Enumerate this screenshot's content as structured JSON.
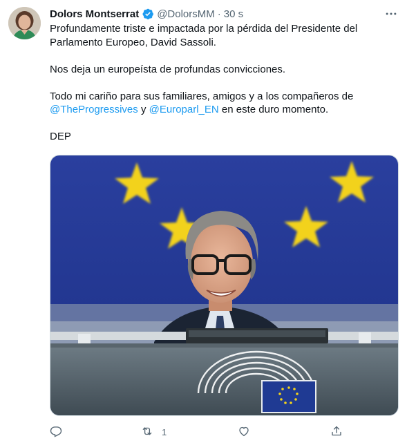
{
  "tweet": {
    "author_name": "Dolors Montserrat",
    "handle": "@DolorsMM",
    "separator": "·",
    "time": "30 s",
    "line1": "Profundamente triste e impactada por la pérdida del Presidente del",
    "line2": "Parlamento Europeo, David Sassoli.",
    "para2": "Nos deja un europeísta de profundas convicciones.",
    "para3_line1": "Todo mi cariño para sus familiares, amigos y a los compañeros de",
    "mention1": "@TheProgressives",
    "and": " y ",
    "mention2": "@Europarl_EN",
    "para3_end": " en este duro momento.",
    "para4": "DEP"
  },
  "actions": {
    "retweet_count": "1"
  },
  "icons": {
    "verified": "verified-badge-icon",
    "more": "more-options-icon",
    "reply": "reply-icon",
    "retweet": "retweet-icon",
    "like": "like-icon",
    "share": "share-icon"
  },
  "colors": {
    "accent": "#1d9bf0",
    "secondary_text": "#536471",
    "primary_text": "#0f1419",
    "eu_blue": "#1f3a93",
    "eu_star": "#f2d21a"
  }
}
